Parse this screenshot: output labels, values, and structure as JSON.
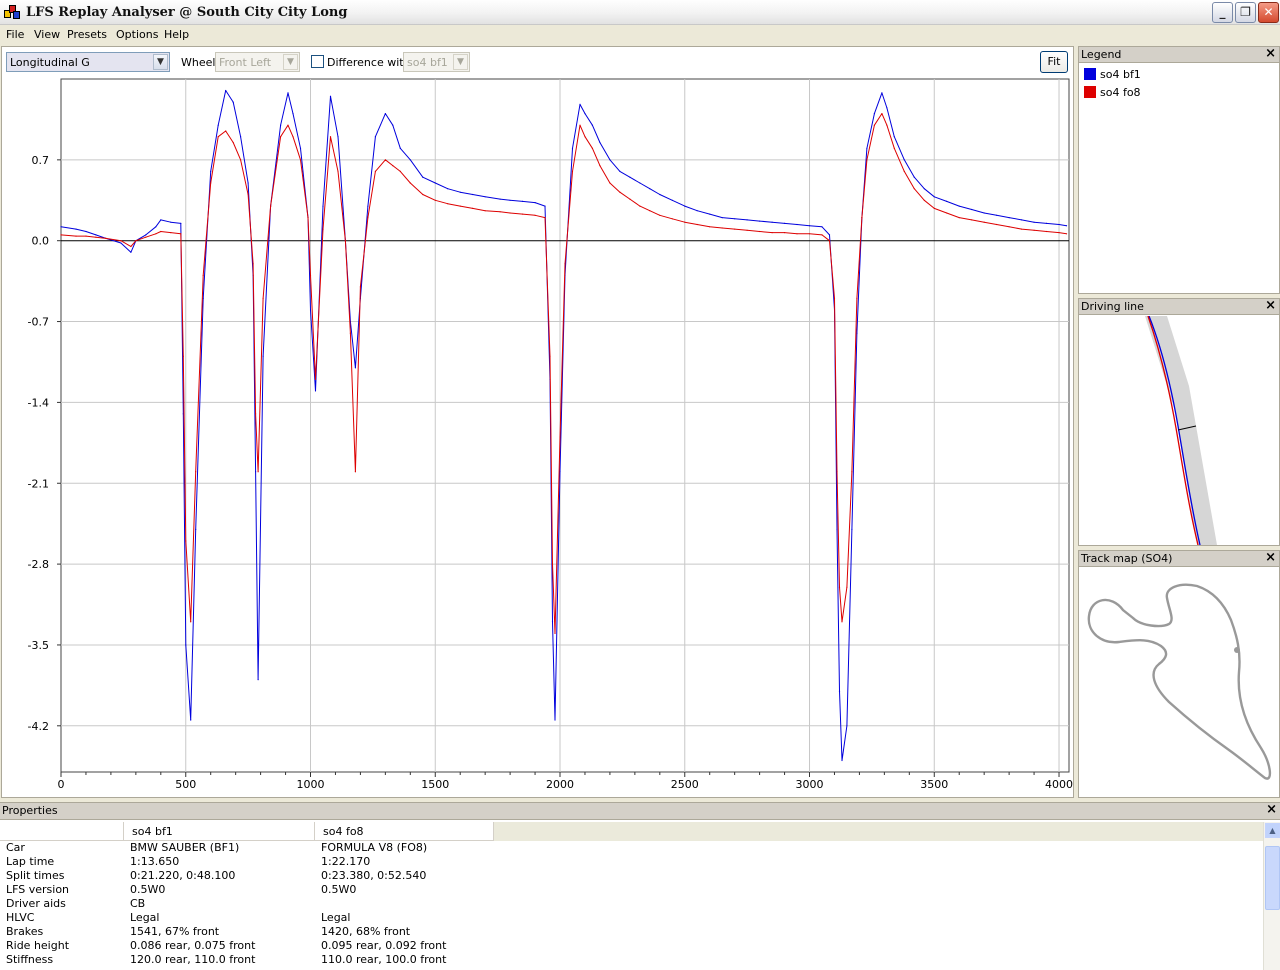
{
  "window": {
    "title": "LFS Replay Analyser @ South City City Long"
  },
  "menu": [
    "File",
    "View",
    "Presets",
    "Options",
    "Help"
  ],
  "toolbar": {
    "channel": "Longitudinal G",
    "wheel_label": "Wheel",
    "wheel_value": "Front Left",
    "difference_label": "Difference with",
    "difference_value": "so4 bf1",
    "fit_label": "Fit"
  },
  "colors": {
    "series_bf1": "#0000dd",
    "series_fo8": "#dd0000"
  },
  "chart_data": {
    "type": "line",
    "xlim": [
      0,
      4040
    ],
    "ylim": [
      -4.6,
      1.4
    ],
    "x_ticks": [
      0,
      500,
      1000,
      1500,
      2000,
      2500,
      3000,
      3500,
      4000
    ],
    "y_ticks": [
      0.7,
      0.0,
      -0.7,
      -1.4,
      -2.1,
      -2.8,
      -3.5,
      -4.2
    ],
    "y_tick_labels": [
      "0.7",
      "0.0",
      "-0.7",
      "-1.4",
      "-2.1",
      "-2.8",
      "-3.5",
      "-4.2"
    ],
    "grid": true,
    "series": [
      {
        "name": "so4 bf1",
        "x": [
          0,
          60,
          100,
          140,
          180,
          240,
          280,
          300,
          340,
          380,
          400,
          440,
          480,
          490,
          500,
          520,
          540,
          570,
          600,
          630,
          660,
          690,
          720,
          750,
          770,
          780,
          790,
          810,
          840,
          880,
          910,
          930,
          960,
          990,
          1000,
          1020,
          1050,
          1080,
          1110,
          1140,
          1160,
          1180,
          1200,
          1230,
          1260,
          1300,
          1330,
          1360,
          1400,
          1450,
          1500,
          1550,
          1600,
          1650,
          1700,
          1760,
          1800,
          1850,
          1900,
          1940,
          1960,
          1970,
          1980,
          2000,
          2020,
          2050,
          2080,
          2100,
          2130,
          2160,
          2200,
          2240,
          2280,
          2320,
          2360,
          2400,
          2450,
          2500,
          2550,
          2600,
          2650,
          2700,
          2750,
          2800,
          2850,
          2900,
          2950,
          3000,
          3050,
          3080,
          3100,
          3110,
          3120,
          3130,
          3150,
          3170,
          3190,
          3210,
          3230,
          3260,
          3290,
          3310,
          3340,
          3380,
          3420,
          3460,
          3500,
          3550,
          3600,
          3650,
          3700,
          3750,
          3800,
          3850,
          3900,
          3950,
          4000,
          4030
        ],
        "y": [
          0.12,
          0.1,
          0.08,
          0.05,
          0.02,
          -0.02,
          -0.1,
          0.0,
          0.05,
          0.12,
          0.18,
          0.16,
          0.15,
          -1.5,
          -3.5,
          -4.15,
          -2.5,
          -0.5,
          0.6,
          1.0,
          1.3,
          1.2,
          0.9,
          0.5,
          -0.3,
          -2.0,
          -3.8,
          -1.0,
          0.3,
          1.0,
          1.28,
          1.1,
          0.8,
          0.2,
          -0.6,
          -1.3,
          0.3,
          1.25,
          0.9,
          0.0,
          -0.7,
          -1.1,
          -0.5,
          0.3,
          0.9,
          1.1,
          1.0,
          0.8,
          0.7,
          0.55,
          0.5,
          0.45,
          0.42,
          0.4,
          0.38,
          0.36,
          0.35,
          0.34,
          0.33,
          0.3,
          -1.2,
          -3.3,
          -4.15,
          -2.0,
          -0.3,
          0.8,
          1.18,
          1.1,
          1.0,
          0.85,
          0.7,
          0.6,
          0.55,
          0.5,
          0.45,
          0.4,
          0.35,
          0.3,
          0.26,
          0.23,
          0.2,
          0.19,
          0.18,
          0.17,
          0.16,
          0.15,
          0.14,
          0.13,
          0.12,
          0.05,
          -0.6,
          -2.5,
          -3.9,
          -4.5,
          -4.2,
          -2.5,
          -0.8,
          0.2,
          0.8,
          1.1,
          1.28,
          1.15,
          0.9,
          0.7,
          0.55,
          0.45,
          0.38,
          0.34,
          0.3,
          0.27,
          0.24,
          0.22,
          0.2,
          0.18,
          0.16,
          0.15,
          0.14,
          0.13
        ]
      },
      {
        "name": "so4 fo8",
        "x": [
          0,
          60,
          100,
          140,
          180,
          240,
          280,
          300,
          340,
          380,
          400,
          440,
          480,
          490,
          500,
          520,
          540,
          570,
          600,
          630,
          660,
          690,
          720,
          750,
          770,
          780,
          790,
          810,
          840,
          880,
          910,
          930,
          960,
          990,
          1000,
          1020,
          1050,
          1080,
          1110,
          1140,
          1160,
          1180,
          1200,
          1230,
          1260,
          1300,
          1330,
          1360,
          1400,
          1450,
          1500,
          1550,
          1600,
          1650,
          1700,
          1760,
          1800,
          1850,
          1900,
          1940,
          1960,
          1970,
          1980,
          2000,
          2020,
          2050,
          2080,
          2100,
          2130,
          2160,
          2200,
          2240,
          2280,
          2320,
          2360,
          2400,
          2450,
          2500,
          2550,
          2600,
          2650,
          2700,
          2750,
          2800,
          2850,
          2900,
          2950,
          3000,
          3050,
          3080,
          3100,
          3110,
          3120,
          3130,
          3150,
          3170,
          3190,
          3210,
          3230,
          3260,
          3290,
          3310,
          3340,
          3380,
          3420,
          3460,
          3500,
          3550,
          3600,
          3650,
          3700,
          3750,
          3800,
          3850,
          3900,
          3950,
          4000,
          4030
        ],
        "y": [
          0.05,
          0.04,
          0.04,
          0.03,
          0.02,
          0.0,
          -0.05,
          0.0,
          0.03,
          0.06,
          0.08,
          0.07,
          0.06,
          -1.0,
          -2.6,
          -3.3,
          -2.0,
          -0.3,
          0.5,
          0.9,
          0.95,
          0.85,
          0.7,
          0.4,
          -0.2,
          -1.5,
          -2.0,
          -0.5,
          0.3,
          0.9,
          1.0,
          0.9,
          0.7,
          0.2,
          -0.3,
          -1.2,
          0.1,
          0.9,
          0.6,
          0.0,
          -0.8,
          -2.0,
          -0.4,
          0.2,
          0.6,
          0.7,
          0.65,
          0.6,
          0.5,
          0.4,
          0.35,
          0.32,
          0.3,
          0.28,
          0.26,
          0.25,
          0.24,
          0.23,
          0.22,
          0.2,
          -1.0,
          -2.8,
          -3.4,
          -1.7,
          -0.2,
          0.6,
          1.0,
          0.9,
          0.8,
          0.65,
          0.5,
          0.42,
          0.36,
          0.3,
          0.26,
          0.22,
          0.19,
          0.16,
          0.14,
          0.12,
          0.11,
          0.1,
          0.09,
          0.08,
          0.07,
          0.07,
          0.06,
          0.06,
          0.05,
          0.0,
          -0.5,
          -2.0,
          -3.0,
          -3.3,
          -3.0,
          -2.0,
          -0.5,
          0.2,
          0.7,
          1.0,
          1.1,
          1.0,
          0.8,
          0.6,
          0.45,
          0.35,
          0.28,
          0.24,
          0.2,
          0.18,
          0.16,
          0.14,
          0.12,
          0.1,
          0.09,
          0.08,
          0.07,
          0.06
        ]
      }
    ]
  },
  "panels": {
    "legend": {
      "title": "Legend",
      "items": [
        {
          "label": "so4 bf1",
          "color": "#0000dd"
        },
        {
          "label": "so4 fo8",
          "color": "#dd0000"
        }
      ]
    },
    "driving_line": {
      "title": "Driving line"
    },
    "track_map": {
      "title": "Track map (SO4)"
    }
  },
  "properties": {
    "title": "Properties",
    "columns": [
      "so4 bf1",
      "so4 fo8"
    ],
    "rows": [
      {
        "name": "Car",
        "a": "BMW SAUBER (BF1)",
        "b": "FORMULA V8 (FO8)"
      },
      {
        "name": "Lap time",
        "a": "1:13.650",
        "b": "1:22.170"
      },
      {
        "name": "Split times",
        "a": "0:21.220, 0:48.100",
        "b": "0:23.380, 0:52.540"
      },
      {
        "name": "LFS version",
        "a": "0.5W0",
        "b": "0.5W0"
      },
      {
        "name": "Driver aids",
        "a": "CB",
        "b": ""
      },
      {
        "name": "HLVC",
        "a": "Legal",
        "b": "Legal"
      },
      {
        "name": "Brakes",
        "a": "1541, 67% front",
        "b": "1420, 68% front"
      },
      {
        "name": "Ride height",
        "a": "0.086 rear, 0.075 front",
        "b": "0.095 rear, 0.092 front"
      },
      {
        "name": "Stiffness",
        "a": "120.0 rear, 110.0 front",
        "b": "110.0 rear, 100.0 front"
      }
    ]
  }
}
